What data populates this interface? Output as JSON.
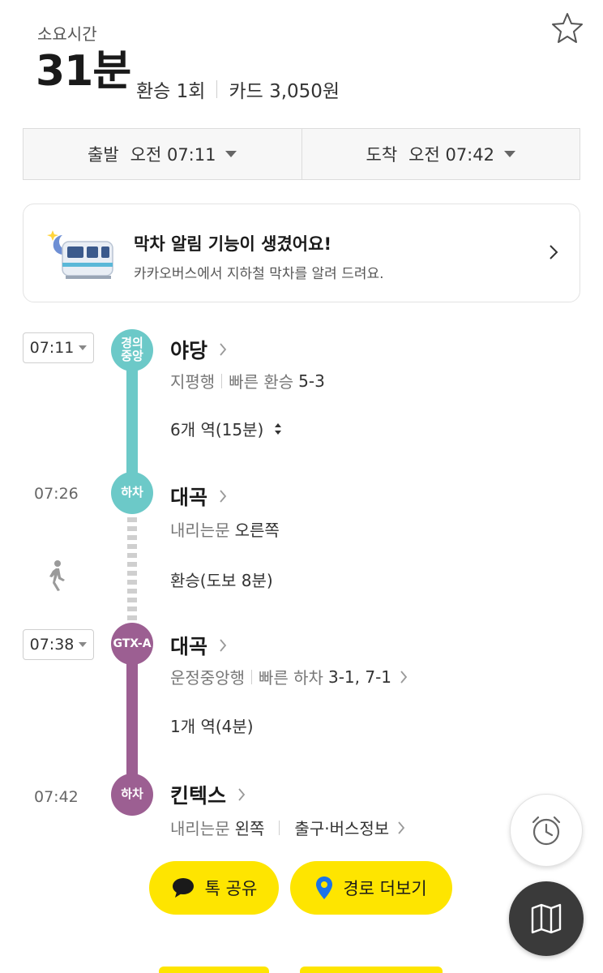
{
  "header": {
    "duration_label": "소요시간",
    "duration": "31분",
    "transfers": "환승 1회",
    "fare": "카드 3,050원"
  },
  "time_bar": {
    "depart_label": "출발",
    "depart_time": "오전 07:11",
    "arrive_label": "도착",
    "arrive_time": "오전 07:42"
  },
  "banner": {
    "title": "막차 알림 기능이 생겼어요!",
    "subtitle": "카카오버스에서 지하철 막차를 알려 드려요."
  },
  "route": {
    "leg1": {
      "time": "07:11",
      "line_badge": [
        "경의",
        "중앙"
      ],
      "station": "야당",
      "direction": "지평행",
      "fast_label": "빠른 환승",
      "fast_value": "5-3",
      "stops": "6개 역(15분)"
    },
    "alight1": {
      "time": "07:26",
      "badge": "하차",
      "station": "대곡",
      "door_label": "내리는문",
      "door_value": "오른쪽"
    },
    "walk": {
      "text": "환승(도보 8분)"
    },
    "leg2": {
      "time": "07:38",
      "line_badge": "GTX-A",
      "station": "대곡",
      "direction": "운정중앙행",
      "fast_label": "빠른 하차",
      "fast_value": "3-1, 7-1",
      "stops": "1개 역(4분)"
    },
    "alight2": {
      "time": "07:42",
      "badge": "하차",
      "station": "킨텍스",
      "door_label": "내리는문",
      "door_value": "왼쪽",
      "exit_info": "출구·버스정보"
    }
  },
  "actions": {
    "share_label": "톡 공유",
    "more_routes_label": "경로 더보기"
  },
  "colors": {
    "gyeongui_line": "#6cc9c8",
    "gtx_a_line": "#9c5f92",
    "kakao_yellow": "#fee500"
  },
  "icons": [
    "star-icon",
    "chevron-right-icon",
    "updown-icon",
    "walk-icon",
    "chat-bubble-icon",
    "location-pin-icon",
    "alarm-clock-icon",
    "map-icon"
  ]
}
